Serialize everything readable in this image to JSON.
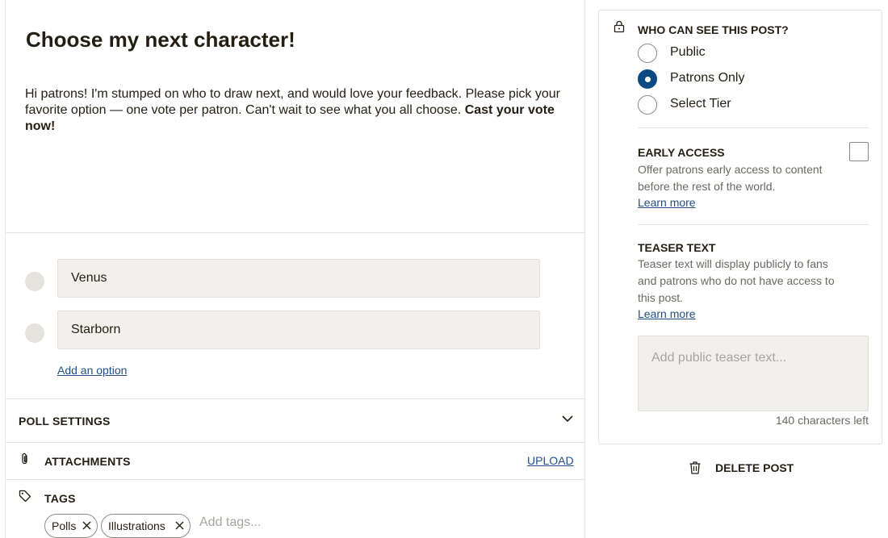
{
  "post": {
    "title": "Choose my next character!",
    "body_text": "Hi patrons! I'm stumped on who to draw next, and would love your feedback. Please pick your favorite option — one vote per patron. Can't wait to see what you all choose. ",
    "body_bold": "Cast your vote now!"
  },
  "poll": {
    "options": [
      {
        "value": "Venus"
      },
      {
        "value": "Starborn"
      }
    ],
    "add_option_label": "Add an option"
  },
  "sections": {
    "poll_settings": "POLL SETTINGS",
    "attachments": "ATTACHMENTS",
    "upload": "UPLOAD",
    "tags": "TAGS"
  },
  "tags": {
    "items": [
      "Polls",
      "Illustrations"
    ],
    "placeholder": "Add tags..."
  },
  "visibility": {
    "heading": "WHO CAN SEE THIS POST?",
    "options": [
      {
        "label": "Public",
        "selected": false
      },
      {
        "label": "Patrons Only",
        "selected": true
      },
      {
        "label": "Select Tier",
        "selected": false
      }
    ]
  },
  "early_access": {
    "heading": "EARLY ACCESS",
    "description": "Offer patrons early access to content before the rest of the world.",
    "learn_more": "Learn more",
    "checked": false
  },
  "teaser": {
    "heading": "TEASER TEXT",
    "description": "Teaser text will display publicly to fans and patrons who do not have access to this post.",
    "learn_more": "Learn more",
    "placeholder": "Add public teaser text...",
    "chars_left": "140 characters left"
  },
  "actions": {
    "delete_label": "DELETE POST"
  },
  "colors": {
    "accent": "#0b4a82",
    "link": "#1f4e87",
    "border": "#e5e3dd",
    "input_bg": "#f1f0ed"
  }
}
